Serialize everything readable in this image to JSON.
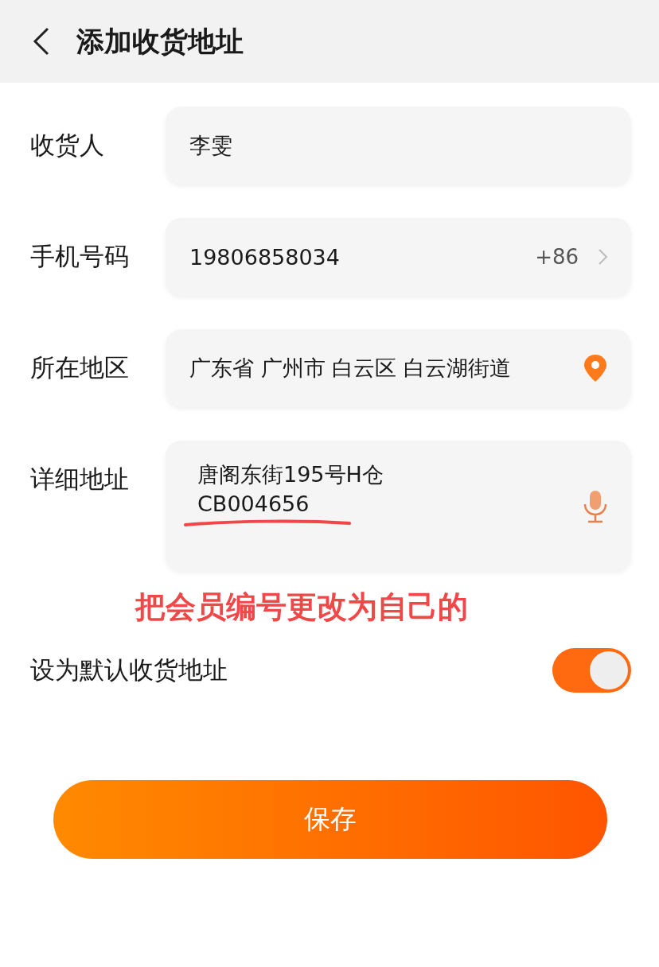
{
  "header": {
    "title": "添加收货地址"
  },
  "fields": [
    {
      "kind": "text",
      "label": "收货人",
      "value": "李雯"
    },
    {
      "kind": "phone",
      "label": "手机号码",
      "value": "19806858034",
      "suffix": "+86"
    },
    {
      "kind": "region",
      "label": "所在地区",
      "value": "广东省 广州市 白云区 白云湖街道"
    },
    {
      "kind": "address",
      "label": "详细地址",
      "value": "唐阁东街195号H仓\nCB004656"
    }
  ],
  "annotation": {
    "text": "把会员编号更改为自己的"
  },
  "default_switch": {
    "label": "设为默认收货地址",
    "on": true
  },
  "save_button": "保存"
}
